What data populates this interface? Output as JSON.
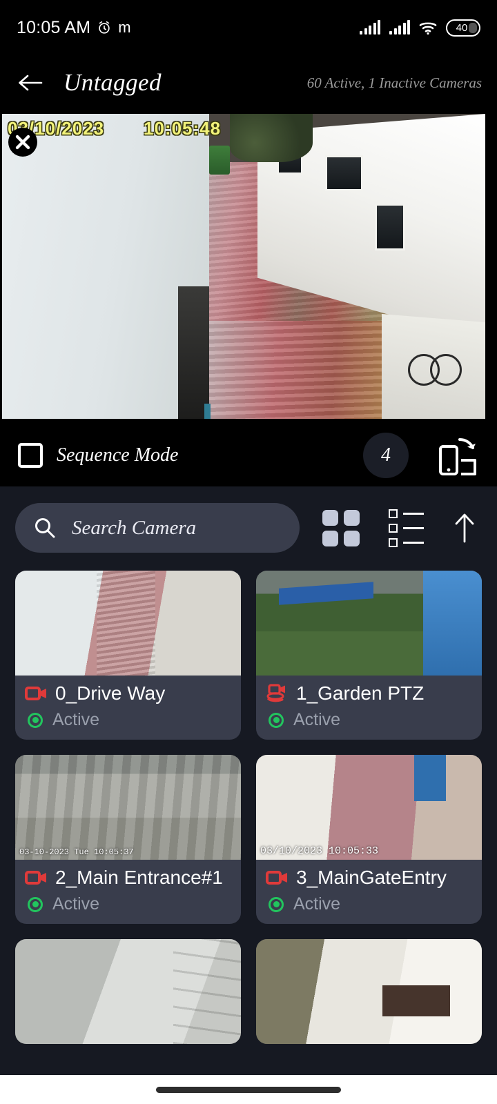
{
  "status_bar": {
    "time": "10:05 AM",
    "alarm_icon": "alarm-clock-icon",
    "app_glyph": "m",
    "battery_level": "40"
  },
  "header": {
    "back_icon": "back-arrow-icon",
    "title": "Untagged",
    "camera_count": "60 Active, 1 Inactive Cameras"
  },
  "player": {
    "close_icon": "close-icon",
    "overlay_date": "03/10/2023",
    "overlay_time": "10:05:48"
  },
  "controls": {
    "sequence_mode_label": "Sequence Mode",
    "sequence_mode_checked": false,
    "layout_count": "4",
    "rotate_icon": "rotate-screen-icon"
  },
  "search": {
    "placeholder": "Search Camera",
    "search_icon": "search-icon",
    "grid_view_icon": "grid-view-icon",
    "list_view_icon": "list-view-icon",
    "sort_icon": "up-arrow-icon"
  },
  "cameras": [
    {
      "name": "0_Drive Way",
      "status": "Active",
      "type": "fixed",
      "thumb_ts": "",
      "scene": "sc1"
    },
    {
      "name": "1_Garden PTZ",
      "status": "Active",
      "type": "ptz",
      "thumb_ts": "",
      "scene": "sc2"
    },
    {
      "name": "2_Main Entrance#1",
      "status": "Active",
      "type": "fixed",
      "thumb_ts": "03-10-2023 Tue 10:05:37",
      "scene": "sc3"
    },
    {
      "name": "3_MainGateEntry",
      "status": "Active",
      "type": "fixed",
      "thumb_ts": "03/10/2023 10:05:33",
      "scene": "sc4"
    },
    {
      "name": "",
      "status": "",
      "type": "fixed",
      "thumb_ts": "",
      "scene": "sc5"
    },
    {
      "name": "",
      "status": "",
      "type": "fixed",
      "thumb_ts": "",
      "scene": "sc6"
    }
  ],
  "colors": {
    "background": "#161922",
    "card": "#393d4c",
    "active_green": "#22c55e",
    "camera_red": "#e03a3a",
    "overlay_yellow": "#f2f27a",
    "icon_grey": "#c3c9da"
  }
}
